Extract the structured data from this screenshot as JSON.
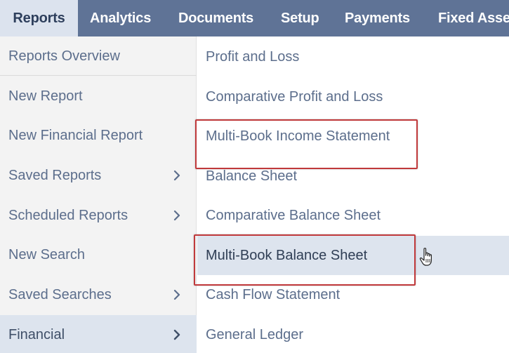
{
  "topnav": {
    "tabs": [
      {
        "label": "Reports",
        "active": true
      },
      {
        "label": "Analytics"
      },
      {
        "label": "Documents"
      },
      {
        "label": "Setup"
      },
      {
        "label": "Payments"
      },
      {
        "label": "Fixed Asse"
      }
    ]
  },
  "left_menu": {
    "items": [
      {
        "label": "Reports Overview",
        "has_submenu": false
      },
      {
        "label": "New Report",
        "has_submenu": false
      },
      {
        "label": "New Financial Report",
        "has_submenu": false
      },
      {
        "label": "Saved Reports",
        "has_submenu": true
      },
      {
        "label": "Scheduled Reports",
        "has_submenu": true
      },
      {
        "label": "New Search",
        "has_submenu": false
      },
      {
        "label": "Saved Searches",
        "has_submenu": true
      },
      {
        "label": "Financial",
        "has_submenu": true,
        "active": true
      }
    ]
  },
  "submenu": {
    "items": [
      {
        "label": "Profit and Loss"
      },
      {
        "label": "Comparative Profit and Loss"
      },
      {
        "label": "Multi-Book Income Statement",
        "annotated": true
      },
      {
        "label": "Balance Sheet"
      },
      {
        "label": "Comparative Balance Sheet"
      },
      {
        "label": "Multi-Book Balance Sheet",
        "annotated": true,
        "hovered": true
      },
      {
        "label": "Cash Flow Statement"
      },
      {
        "label": "General Ledger"
      }
    ]
  },
  "colors": {
    "nav_bg": "#5f7396",
    "active_tab_bg": "#dce3ee",
    "menu_text": "#5c6e8c",
    "annotation_border": "#c0393b"
  }
}
